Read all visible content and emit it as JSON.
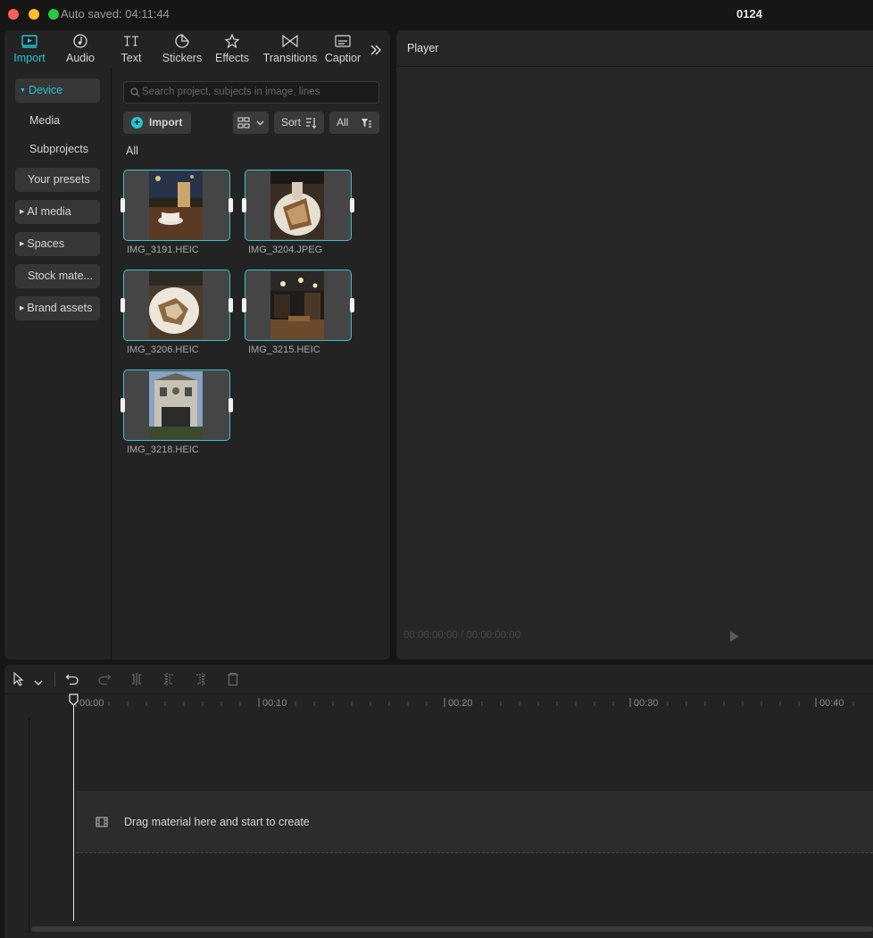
{
  "window": {
    "autosave_text": "Auto saved: 04:11:44",
    "project_title": "0124"
  },
  "toptabs": [
    {
      "label": "Import",
      "icon": "import-icon",
      "active": true
    },
    {
      "label": "Audio",
      "icon": "audio-icon"
    },
    {
      "label": "Text",
      "icon": "text-icon"
    },
    {
      "label": "Stickers",
      "icon": "stickers-icon"
    },
    {
      "label": "Effects",
      "icon": "effects-icon"
    },
    {
      "label": "Transitions",
      "icon": "transitions-icon"
    },
    {
      "label": "Captior",
      "icon": "captions-icon"
    }
  ],
  "sidebar": {
    "items": [
      {
        "label": "Device",
        "expandable": true,
        "active": true
      },
      {
        "label": "Media"
      },
      {
        "label": "Subprojects"
      },
      {
        "label": "Your presets"
      },
      {
        "label": "AI media",
        "expandable": true
      },
      {
        "label": "Spaces",
        "expandable": true
      },
      {
        "label": "Stock mate...",
        "expandable": false
      },
      {
        "label": "Brand assets",
        "expandable": true
      }
    ]
  },
  "media": {
    "search_placeholder": "Search project, subjects in image, lines",
    "import_label": "Import",
    "sort_label": "Sort",
    "filter_label": "All",
    "section_label": "All",
    "files": [
      {
        "name": "IMG_3191.HEIC"
      },
      {
        "name": "IMG_3204.JPEG"
      },
      {
        "name": "IMG_3206.HEIC"
      },
      {
        "name": "IMG_3215.HEIC"
      },
      {
        "name": "IMG_3218.HEIC"
      }
    ]
  },
  "player": {
    "title": "Player",
    "timecode": "00:00:00:00 / 00:00:00:00"
  },
  "timeline": {
    "ruler_labels": [
      "00:00",
      "00:10",
      "00:20",
      "00:30",
      "00:40"
    ],
    "drop_hint": "Drag material here and start to create"
  },
  "colors": {
    "accent": "#22c7d5",
    "thumb_border": "#3fc1c9"
  }
}
